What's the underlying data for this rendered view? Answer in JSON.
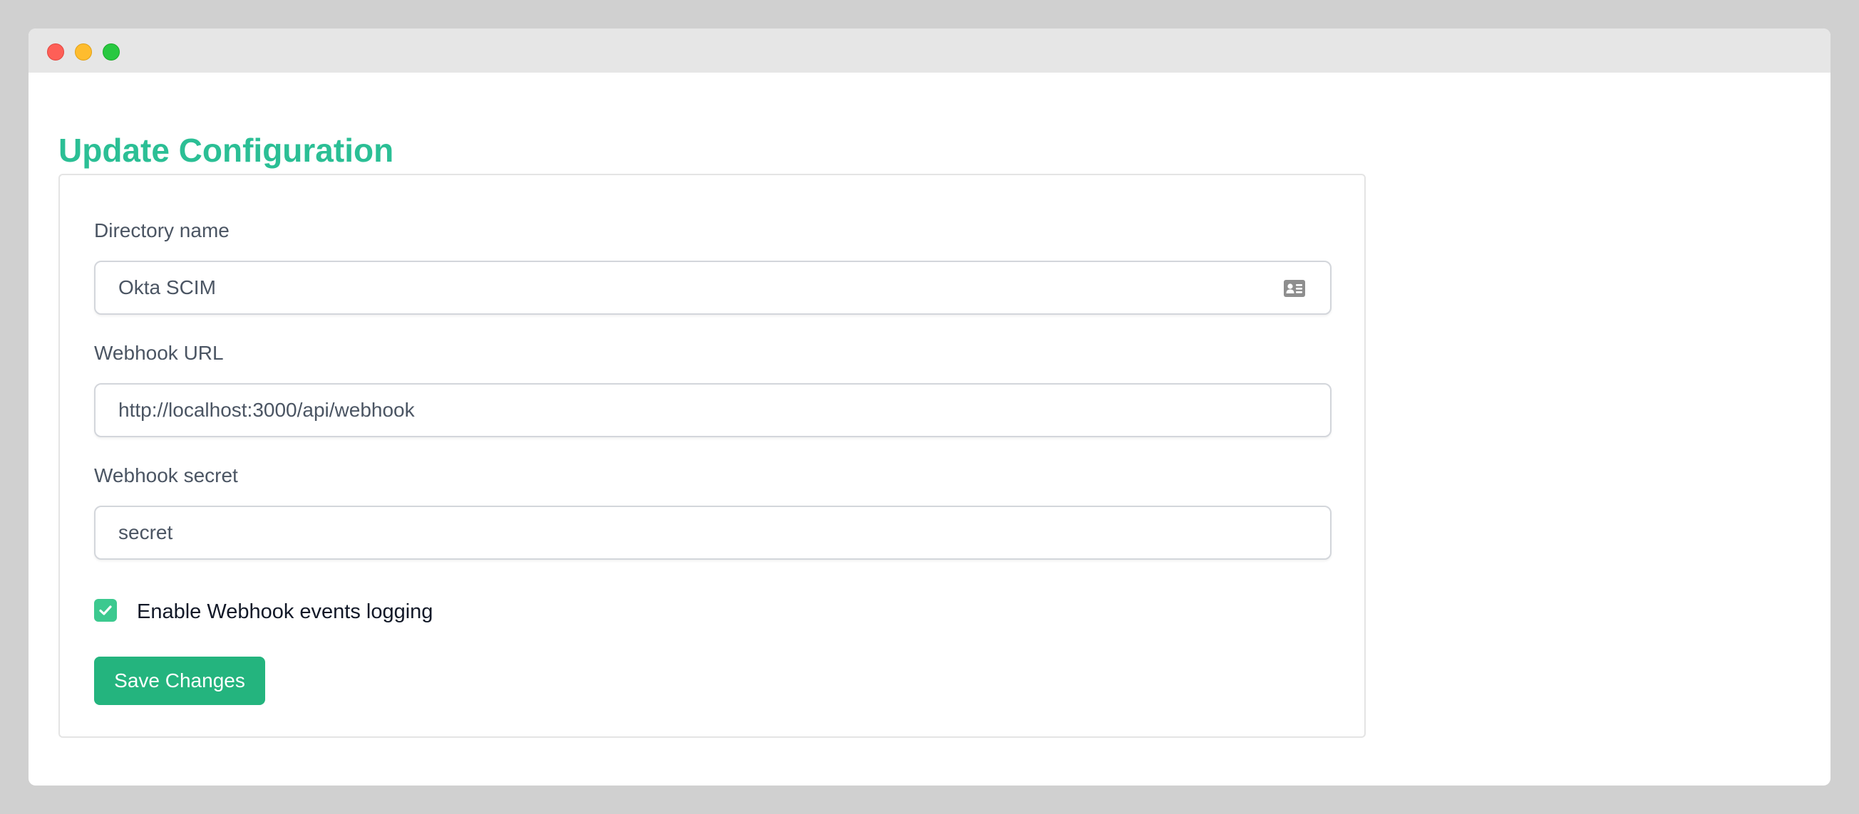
{
  "window": {
    "controls": [
      "close",
      "minimize",
      "maximize"
    ],
    "colors": {
      "close": "#fe5f57",
      "minimize": "#febc2e",
      "maximize": "#28c840"
    }
  },
  "page": {
    "title": "Update Configuration",
    "accent_color": "#2bbf95"
  },
  "form": {
    "directory_name": {
      "label": "Directory name",
      "value": "Okta SCIM",
      "icon": "contact-card-icon"
    },
    "webhook_url": {
      "label": "Webhook URL",
      "value": "http://localhost:3000/api/webhook"
    },
    "webhook_secret": {
      "label": "Webhook secret",
      "value": "secret"
    },
    "logging_checkbox": {
      "label": "Enable Webhook events logging",
      "checked": true,
      "color": "#3cc98f"
    },
    "save_button": {
      "label": "Save Changes",
      "color": "#24b47e"
    }
  }
}
